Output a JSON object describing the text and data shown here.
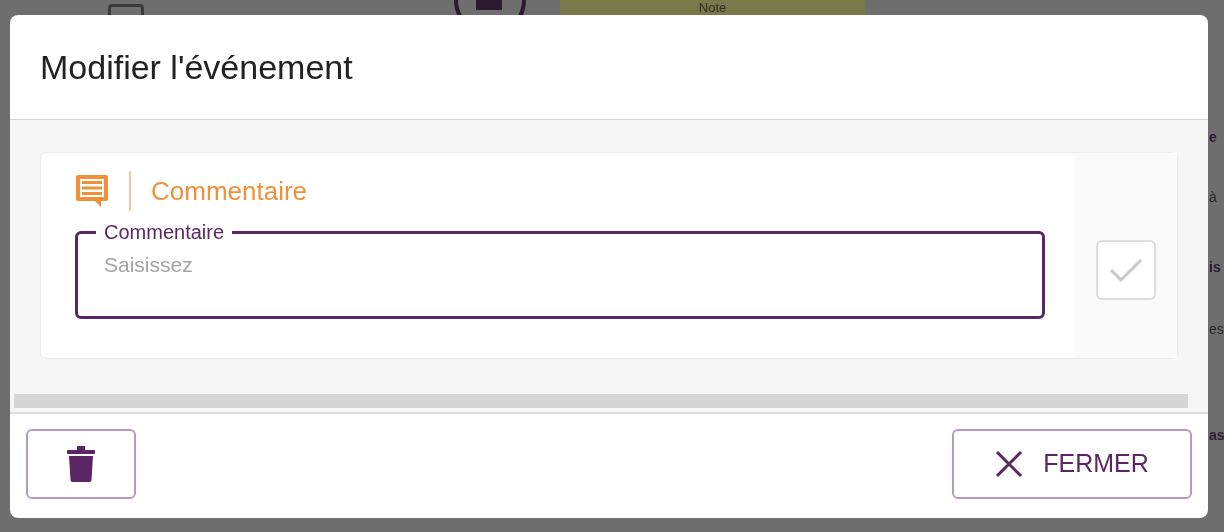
{
  "background": {
    "note_label": "Note",
    "edge_fragments": [
      {
        "text": "e",
        "bold": true
      },
      {
        "text": "à",
        "bold": false
      },
      {
        "text": "is",
        "bold": true
      },
      {
        "text": "es",
        "bold": false
      },
      {
        "text": "as",
        "bold": true
      }
    ]
  },
  "dialog": {
    "title": "Modifier l'événement",
    "section": {
      "title": "Commentaire"
    },
    "field": {
      "label": "Commentaire",
      "placeholder": "Saisissez",
      "focused": true
    },
    "confirm": {
      "disabled": true
    },
    "buttons": [
      {
        "kind": "delete"
      },
      {
        "kind": "close",
        "label": "FERMER"
      }
    ]
  }
}
